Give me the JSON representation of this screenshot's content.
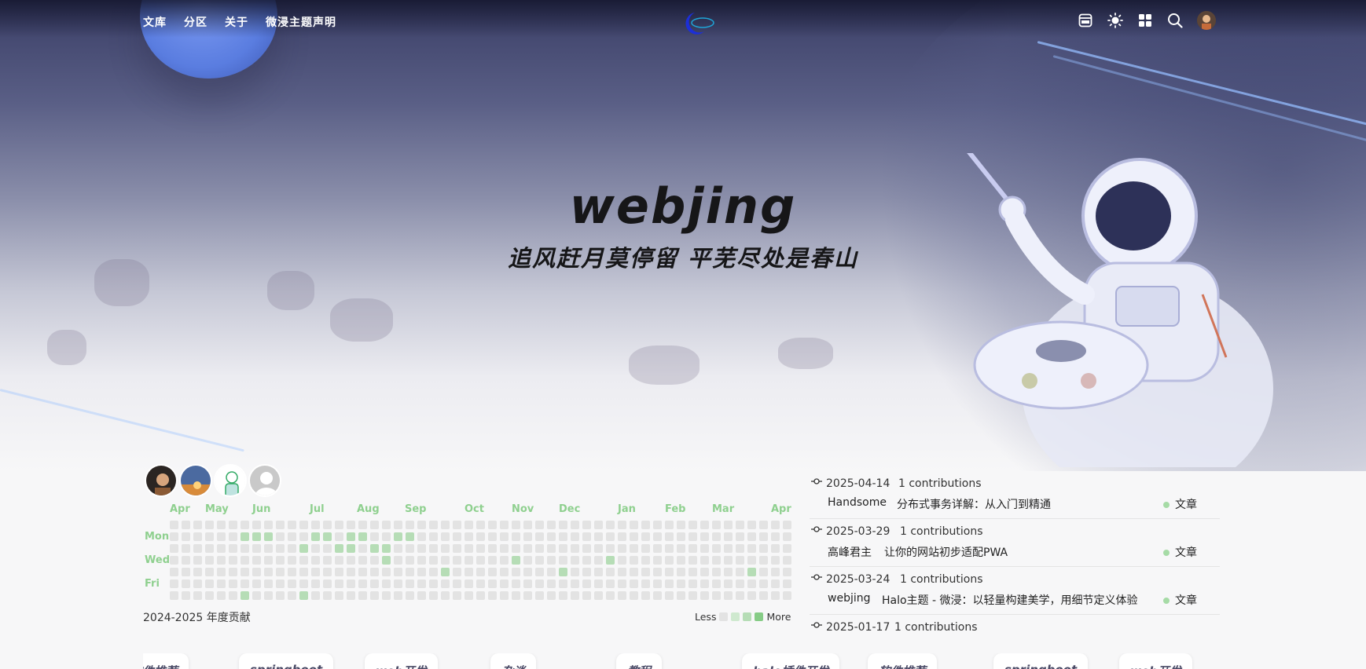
{
  "nav": {
    "links": [
      "文库",
      "分区",
      "关于",
      "微浸主题声明"
    ],
    "logo_icon": "crescent-logo-icon",
    "icons": [
      "app-window-icon",
      "sun-theme-icon",
      "grid-apps-icon",
      "search-icon",
      "user-avatar"
    ]
  },
  "hero": {
    "title": "webjing",
    "subtitle": "追风赶月莫停留 平芜尽处是春山"
  },
  "contributions": {
    "friend_avatars": [
      "avatar-1",
      "avatar-2",
      "avatar-3",
      "avatar-4"
    ],
    "months": [
      "Apr",
      "May",
      "Jun",
      "Jul",
      "Aug",
      "Sep",
      "Oct",
      "Nov",
      "Dec",
      "Jan",
      "Feb",
      "Mar",
      "Apr"
    ],
    "day_labels": [
      "Mon",
      "Wed",
      "Fri"
    ],
    "year_label": "2024-2025 年度贡献",
    "legend_less": "Less",
    "legend_more": "More",
    "colors": {
      "empty": "#e3e3e3",
      "l1": "#cfe9cf",
      "l2": "#b6ddb6",
      "l3": "#9fd49f",
      "l4": "#86cc86"
    },
    "active_cells": [
      [
        6,
        1
      ],
      [
        6,
        6
      ],
      [
        7,
        1
      ],
      [
        8,
        1
      ],
      [
        11,
        2
      ],
      [
        11,
        6
      ],
      [
        12,
        1
      ],
      [
        13,
        1
      ],
      [
        14,
        2
      ],
      [
        15,
        1
      ],
      [
        15,
        2
      ],
      [
        16,
        1
      ],
      [
        17,
        2
      ],
      [
        18,
        2
      ],
      [
        18,
        3
      ],
      [
        19,
        1
      ],
      [
        20,
        1
      ],
      [
        23,
        4
      ],
      [
        29,
        3
      ],
      [
        33,
        4
      ],
      [
        37,
        3
      ],
      [
        49,
        4
      ],
      [
        59,
        2
      ],
      [
        59,
        6
      ],
      [
        65,
        2
      ]
    ]
  },
  "recent": [
    {
      "date": "2025-04-14",
      "contrib": "1 contributions",
      "author": "Handsome",
      "title": "分布式事务详解：从入门到精通",
      "type": "文章"
    },
    {
      "date": "2025-03-29",
      "contrib": "1 contributions",
      "author": "高峰君主",
      "title": "让你的网站初步适配PWA",
      "type": "文章"
    },
    {
      "date": "2025-03-24",
      "contrib": "1 contributions",
      "author": "webjing",
      "title": "Halo主题 - 微浸：以轻量构建美学，用细节定义体验",
      "type": "文章"
    },
    {
      "date": "2025-01-17",
      "contrib": "1 contributions",
      "author": "",
      "title": "",
      "type": ""
    }
  ],
  "categories": [
    "软件推荐",
    "springboot",
    "web开发",
    "杂谈",
    "教程",
    "halo插件开发",
    "软件推荐",
    "springboot",
    "web开发"
  ]
}
